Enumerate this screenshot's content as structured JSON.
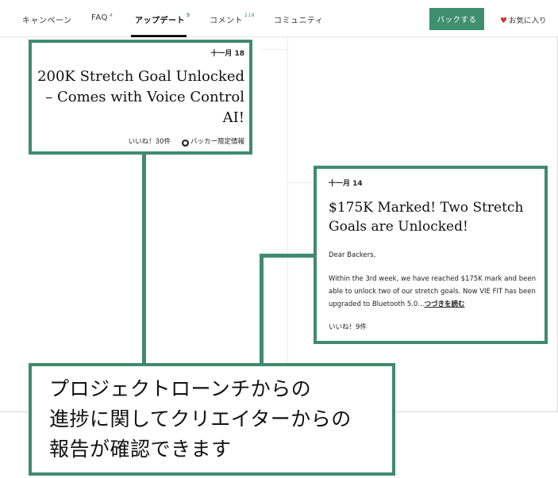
{
  "nav": {
    "tabs": [
      {
        "label": "キャンペーン",
        "count": ""
      },
      {
        "label": "FAQ",
        "count": "4"
      },
      {
        "label": "アップデート",
        "count": "5"
      },
      {
        "label": "コメント",
        "count": "218"
      },
      {
        "label": "コミュニティ",
        "count": ""
      }
    ],
    "back_label": "バックする",
    "favorite_label": "お気に入り"
  },
  "updates": [
    {
      "date": "十一月 18",
      "title": "200K Stretch Goal Unlocked – Comes with Voice Control AI!",
      "likes": "いいね！30件",
      "backer_only": "バッカー限定情報"
    },
    {
      "date": "十一月 14",
      "title": "$175K Marked! Two Stretch Goals are Unlocked!",
      "greeting": "Dear Backers,",
      "body": "Within the 3rd week, we have reached $175K mark and been able to unlock two of our stretch goals. Now VIE FIT has been upgraded to Bluetooth 5.0...",
      "read_more": "つづきを読む",
      "likes": "いいね！9件"
    }
  ],
  "caption": {
    "lines": [
      "プロジェクトローンチからの",
      "進捗に関してクリエイターからの",
      "報告が確認できます"
    ]
  },
  "colors": {
    "accent": "#3f8b70",
    "button": "#3e8e70",
    "heart": "#d0342c"
  },
  "icons": {
    "heart": "heart-icon",
    "lock": "lock-icon"
  }
}
